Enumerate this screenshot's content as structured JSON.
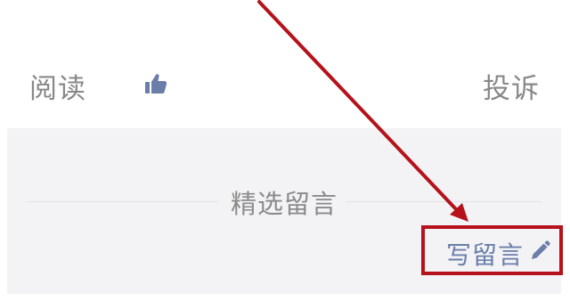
{
  "action_bar": {
    "read_label": "阅读",
    "like_icon": "thumbs-up-icon",
    "complain_label": "投诉"
  },
  "comments": {
    "section_title": "精选留言",
    "write_comment_label": "写留言",
    "pencil_icon": "pencil-icon"
  },
  "annotation": {
    "highlight_color": "#b5121b"
  },
  "colors": {
    "link_blue": "#6a7ea9",
    "muted_text": "#888888",
    "panel_bg": "#f3f3f5"
  }
}
